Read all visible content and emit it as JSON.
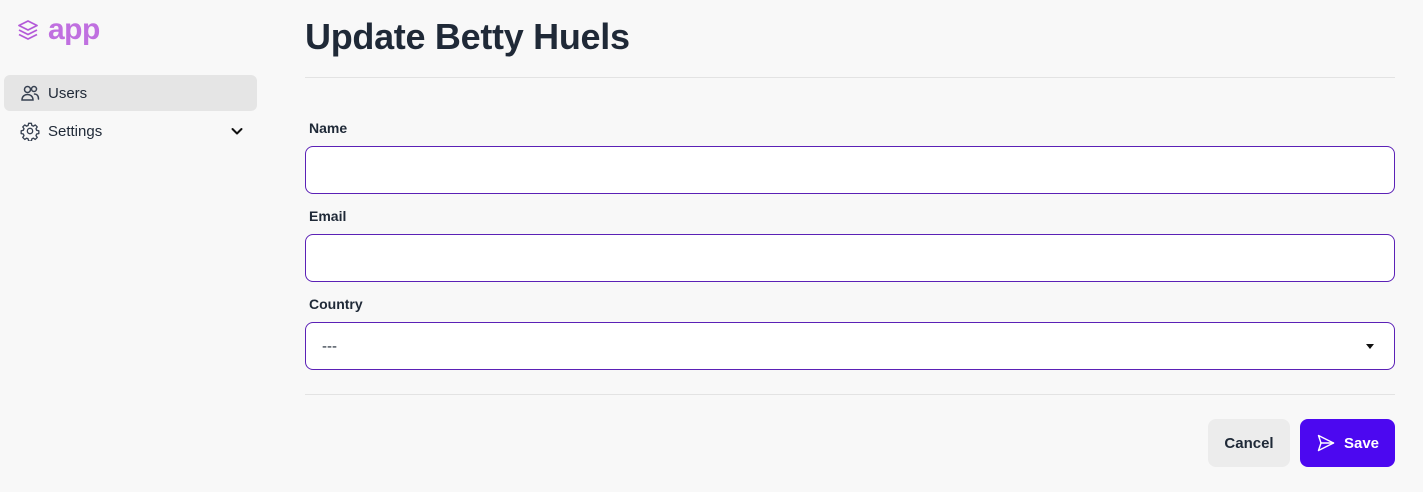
{
  "app": {
    "name": "app"
  },
  "sidebar": {
    "items": [
      {
        "label": "Users",
        "icon": "users-icon",
        "active": true
      },
      {
        "label": "Settings",
        "icon": "gear-icon",
        "expandable": true
      }
    ]
  },
  "page": {
    "title": "Update Betty Huels"
  },
  "form": {
    "name": {
      "label": "Name",
      "value": ""
    },
    "email": {
      "label": "Email",
      "value": ""
    },
    "country": {
      "label": "Country",
      "value": "---"
    }
  },
  "actions": {
    "cancel_label": "Cancel",
    "save_label": "Save"
  },
  "colors": {
    "accent": "#4c08f0",
    "field_border": "#5b21b6",
    "logo": "#c070e0"
  }
}
